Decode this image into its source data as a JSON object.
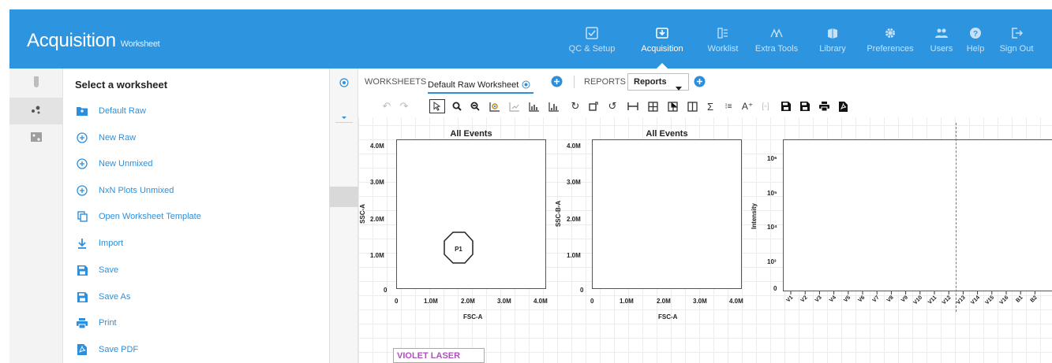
{
  "app": {
    "title": "Acquisition",
    "subtitle": "Worksheet"
  },
  "nav": [
    {
      "label": "QC & Setup",
      "icon": "qc-setup-icon"
    },
    {
      "label": "Acquisition",
      "icon": "acquisition-icon",
      "active": true
    },
    {
      "label": "Worklist",
      "icon": "worklist-icon"
    },
    {
      "label": "Extra Tools",
      "icon": "extra-tools-icon"
    },
    {
      "label": "Library",
      "icon": "library-icon"
    },
    {
      "label": "Preferences",
      "icon": "gear-icon"
    },
    {
      "label": "Users",
      "icon": "users-icon"
    },
    {
      "label": "Help",
      "icon": "help-icon"
    },
    {
      "label": "Sign Out",
      "icon": "sign-out-icon"
    }
  ],
  "panel": {
    "title": "Select a worksheet",
    "items": [
      {
        "label": "Default Raw",
        "icon": "folder-icon"
      },
      {
        "label": "New Raw",
        "icon": "add-circle-icon"
      },
      {
        "label": "New Unmixed",
        "icon": "add-circle-icon"
      },
      {
        "label": "NxN Plots Unmixed",
        "icon": "add-circle-icon"
      },
      {
        "label": "Open Worksheet Template",
        "icon": "copy-icon"
      },
      {
        "label": "Import",
        "icon": "download-icon"
      },
      {
        "label": "Save",
        "icon": "save-icon"
      },
      {
        "label": "Save As",
        "icon": "save-as-icon"
      },
      {
        "label": "Print",
        "icon": "print-icon"
      },
      {
        "label": "Save PDF",
        "icon": "pdf-icon"
      }
    ]
  },
  "tabs": {
    "worksheets_label": "WORKSHEETS",
    "active_worksheet": "Default Raw Worksheet",
    "reports_label": "REPORTS",
    "reports_select": "Reports"
  },
  "plots": [
    {
      "title": "All Events",
      "xlabel": "FSC-A",
      "ylabel": "SSC-A",
      "xticks": [
        "0",
        "1.0M",
        "2.0M",
        "3.0M",
        "4.0M"
      ],
      "yticks": [
        "0",
        "1.0M",
        "2.0M",
        "3.0M",
        "4.0M"
      ],
      "gate_label": "P1"
    },
    {
      "title": "All Events",
      "xlabel": "FSC-A",
      "ylabel": "SSC-B-A",
      "xticks": [
        "0",
        "1.0M",
        "2.0M",
        "3.0M",
        "4.0M"
      ],
      "yticks": [
        "0",
        "1.0M",
        "2.0M",
        "3.0M",
        "4.0M"
      ]
    },
    {
      "title": "",
      "xlabel": "",
      "ylabel": "Intensity",
      "yticks": [
        "0",
        "10³",
        "10⁴",
        "10⁵",
        "10⁶"
      ],
      "channels": [
        "V1",
        "V2",
        "V3",
        "V4",
        "V5",
        "V6",
        "V7",
        "V8",
        "V9",
        "V10",
        "V11",
        "V12",
        "V13",
        "V14",
        "V15",
        "V16",
        "B1",
        "B2"
      ]
    }
  ],
  "laser_label": "VIOLET LASER",
  "colors": {
    "header": "#2d94e0",
    "link": "#2d8fdb",
    "laser": "#b14fc0"
  }
}
